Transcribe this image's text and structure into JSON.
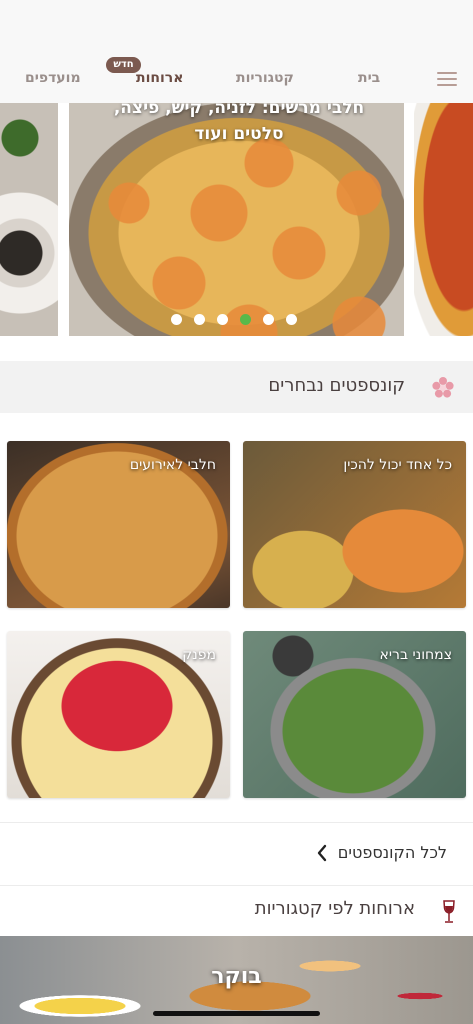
{
  "nav": {
    "tabs": [
      {
        "label": "בית"
      },
      {
        "label": "קטגוריות"
      },
      {
        "label": "ארוחות"
      },
      {
        "label": "מועדפים"
      }
    ],
    "new_badge": "חדש"
  },
  "carousel": {
    "caption": "חלבי מרשים: לזניה, קיש, פיצה, סלטים ועוד",
    "slide_count": 6,
    "active_index": 3
  },
  "concepts": {
    "title": "קונספטים נבחרים",
    "tiles": [
      {
        "label": "כל אחד יכול להכין"
      },
      {
        "label": "חלבי לאירועים"
      },
      {
        "label": "צמחוני בריא"
      },
      {
        "label": "מפנק"
      }
    ],
    "all_link": "לכל הקונספטים"
  },
  "meals": {
    "title": "ארוחות לפי קטגוריות",
    "first_category": "בוקר"
  },
  "colors": {
    "accent_brown": "#7c5a50",
    "active_dot": "#59b94a",
    "flower": "#e89aa8",
    "wine": "#8a1c26"
  }
}
